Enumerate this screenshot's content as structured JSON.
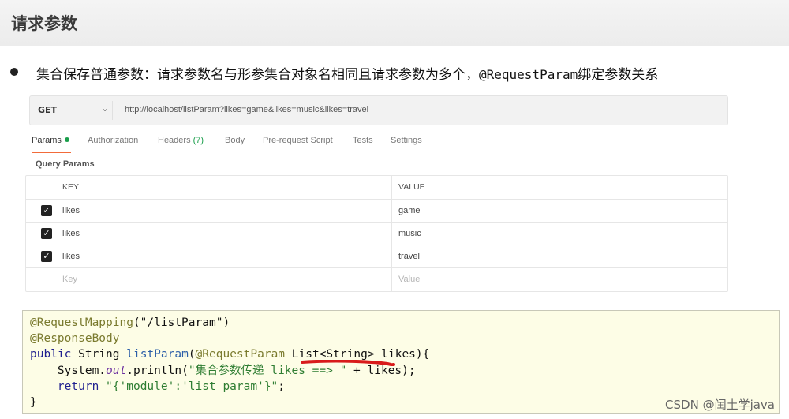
{
  "slide": {
    "title": "请求参数",
    "bullet_text": "集合保存普通参数：请求参数名与形参集合对象名相同且请求参数为多个，",
    "bullet_code": "@RequestParam",
    "bullet_suffix": "绑定参数关系"
  },
  "postman": {
    "method": "GET",
    "url": "http://localhost/listParam?likes=game&likes=music&likes=travel",
    "tabs": [
      {
        "label": "Params"
      },
      {
        "label": "Authorization"
      },
      {
        "label": "Headers"
      },
      {
        "label": "Body"
      },
      {
        "label": "Pre-request Script"
      },
      {
        "label": "Tests"
      },
      {
        "label": "Settings"
      }
    ],
    "headers_count": "(7)",
    "query_params_label": "Query Params",
    "columns": {
      "key": "KEY",
      "value": "VALUE"
    },
    "rows": [
      {
        "key": "likes",
        "value": "game"
      },
      {
        "key": "likes",
        "value": "music"
      },
      {
        "key": "likes",
        "value": "travel"
      }
    ],
    "placeholder": {
      "key": "Key",
      "value": "Value"
    }
  },
  "code": {
    "l1_ann": "@RequestMapping",
    "l1_str": "(\"/listParam\")",
    "l2_ann": "@ResponseBody",
    "l3_kw": "public",
    "l3_type": " String ",
    "l3_fn": "listParam",
    "l3_open": "(",
    "l3_ann": "@RequestParam",
    "l3_rest": " List<String> likes){",
    "l4_pre": "    System.",
    "l4_field": "out",
    "l4_mid": ".println(",
    "l4_str": "\"集合参数传递 likes ==> \"",
    "l4_end": " + likes);",
    "l5_kw": "    return",
    "l5_str": " \"{'module':'list param'}\"",
    "l5_end": ";",
    "l6": "}"
  },
  "watermark": "CSDN @闰土学java"
}
